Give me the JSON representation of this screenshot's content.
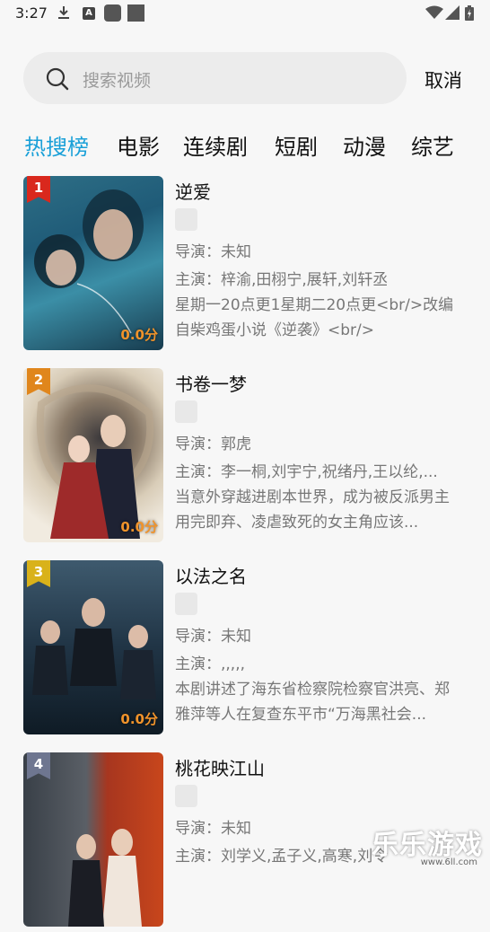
{
  "status_bar": {
    "time": "3:27",
    "a_badge": "A"
  },
  "search": {
    "placeholder": "搜索视频",
    "cancel_label": "取消"
  },
  "tabs": [
    {
      "label": "热搜榜",
      "active": true
    },
    {
      "label": "电影"
    },
    {
      "label": "连续剧"
    },
    {
      "label": "短剧"
    },
    {
      "label": "动漫"
    },
    {
      "label": "综艺"
    }
  ],
  "colors": {
    "accent": "#1aa0d8",
    "rank1": "#d9281d",
    "rank2": "#e0861c",
    "rank3": "#d9b21a",
    "rank4": "#6e7690",
    "score": "#f0932b"
  },
  "items": [
    {
      "rank": "1",
      "title": "逆爱",
      "score": "0.0分",
      "director": "导演：未知",
      "cast": "主演：梓渝,田栩宁,展轩,刘轩丞",
      "desc": "星期一20点更1星期二20点更<br/>改编自柴鸡蛋小说《逆袭》<br/>"
    },
    {
      "rank": "2",
      "title": "书卷一梦",
      "score": "0.0分",
      "director": "导演：郭虎",
      "cast": "主演：李一桐,刘宇宁,祝绪丹,王以纶,...",
      "desc": "当意外穿越进剧本世界，成为被反派男主用完即弃、凌虐致死的女主角应该..."
    },
    {
      "rank": "3",
      "title": "以法之名",
      "score": "0.0分",
      "director": "导演：未知",
      "cast": "主演：,,,,,",
      "desc": "本剧讲述了海东省检察院检察官洪亮、郑雅萍等人在复查东平市“万海黑社会..."
    },
    {
      "rank": "4",
      "title": "桃花映江山",
      "score": "",
      "director": "导演：未知",
      "cast": "主演：刘学义,孟子义,高寒,刘令",
      "desc": ""
    }
  ],
  "watermark": {
    "text": "乐乐游戏",
    "sub": "www.6ll.com"
  }
}
